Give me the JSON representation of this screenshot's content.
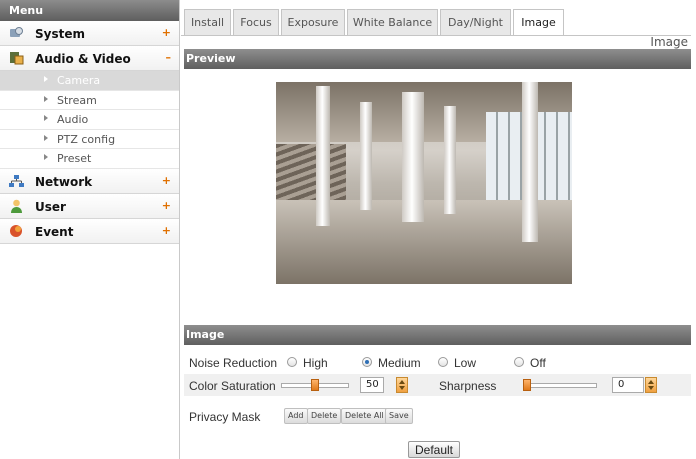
{
  "sidebar": {
    "header": "Menu",
    "items": [
      {
        "label": "System",
        "toggle": "+",
        "icon": "system-icon"
      },
      {
        "label": "Audio & Video",
        "toggle": "–",
        "icon": "audio-video-icon"
      },
      {
        "label": "Network",
        "toggle": "+",
        "icon": "network-icon"
      },
      {
        "label": "User",
        "toggle": "+",
        "icon": "user-icon"
      },
      {
        "label": "Event",
        "toggle": "+",
        "icon": "event-icon"
      }
    ],
    "subitems": [
      "Camera",
      "Stream",
      "Audio",
      "PTZ config",
      "Preset"
    ],
    "active_subitem": "Camera"
  },
  "tabs": [
    "Install",
    "Focus",
    "Exposure",
    "White Balance",
    "Day/Night",
    "Image"
  ],
  "active_tab": "Image",
  "page_title": "Image",
  "preview": {
    "title": "Preview"
  },
  "image": {
    "title": "Image",
    "noise_reduction": {
      "label": "Noise Reduction",
      "options": [
        "High",
        "Medium",
        "Low",
        "Off"
      ],
      "selected": "Medium"
    },
    "color_saturation": {
      "label": "Color Saturation",
      "value": "50",
      "level": 0.5
    },
    "sharpness": {
      "label": "Sharpness",
      "value": "0",
      "level": 0.0
    },
    "privacy_mask": {
      "label": "Privacy Mask",
      "buttons": [
        "Add",
        "Delete",
        "Delete All",
        "Save"
      ]
    },
    "default_button": "Default"
  },
  "colors": {
    "toggle": "#e07000",
    "radio_selected": "#2f6fb5",
    "slider_thumb": "#e07a1a"
  }
}
